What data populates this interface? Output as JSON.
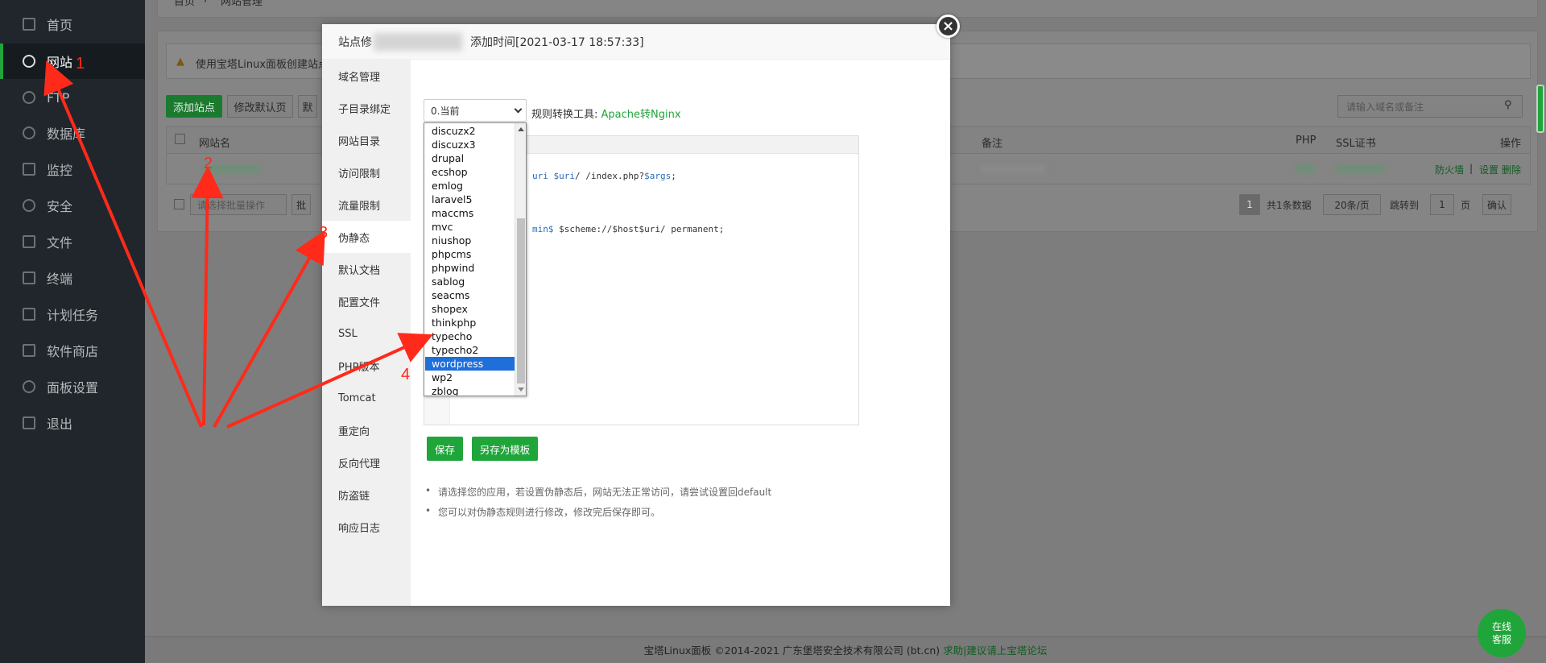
{
  "sidebar": {
    "items": [
      {
        "label": "首页",
        "icon": "home-icon"
      },
      {
        "label": "网站",
        "icon": "globe-icon"
      },
      {
        "label": "FTP",
        "icon": "ftp-icon"
      },
      {
        "label": "数据库",
        "icon": "database-icon"
      },
      {
        "label": "监控",
        "icon": "monitor-icon"
      },
      {
        "label": "安全",
        "icon": "shield-icon"
      },
      {
        "label": "文件",
        "icon": "folder-icon"
      },
      {
        "label": "终端",
        "icon": "terminal-icon"
      },
      {
        "label": "计划任务",
        "icon": "calendar-icon"
      },
      {
        "label": "软件商店",
        "icon": "apps-icon"
      },
      {
        "label": "面板设置",
        "icon": "gear-icon"
      },
      {
        "label": "退出",
        "icon": "logout-icon"
      }
    ]
  },
  "breadcrumb": {
    "home": "首页",
    "sep": "/",
    "current": "网站管理"
  },
  "notice": {
    "text": "使用宝塔Linux面板创建站点时"
  },
  "toolbar": {
    "add_site": "添加站点",
    "modify_default_page": "修改默认页",
    "default_site": "默"
  },
  "search": {
    "placeholder": "请输入域名或备注"
  },
  "table": {
    "headers": {
      "site_name": "网站名",
      "remark": "备注",
      "php": "PHP",
      "ssl": "SSL证书",
      "actions": "操作"
    },
    "row_actions": {
      "firewall": "防火墙",
      "settings": "设置",
      "delete": "删除",
      "sep": "|"
    }
  },
  "batch": {
    "placeholder": "请选择批量操作",
    "button": "批"
  },
  "pagination": {
    "page": "1",
    "total": "共1条数据",
    "per_page": "20条/页",
    "jump_label": "跳转到",
    "jump_value": "1",
    "page_unit": "页",
    "confirm": "确认"
  },
  "modal": {
    "title_prefix": "站点修",
    "title_time": "添加时间[2021-03-17 18:57:33]",
    "tabs": [
      "域名管理",
      "子目录绑定",
      "网站目录",
      "访问限制",
      "流量限制",
      "伪静态",
      "默认文档",
      "配置文件",
      "SSL",
      "PHP版本",
      "Tomcat",
      "重定向",
      "反向代理",
      "防盗链",
      "响应日志"
    ],
    "active_tab": "伪静态",
    "select_value": "0.当前",
    "tool_label": "规则转换工具:",
    "tool_link": "Apache转Nginx",
    "code_line1_a": "uri ",
    "code_line1_b": "$uri",
    "code_line1_c": "/ /index.php?",
    "code_line1_d": "$args",
    "code_line1_e": ";",
    "code_line2_a": "min$ ",
    "code_line2_b": "$scheme://$host$uri/ permanent;",
    "dropdown_options": [
      "discuzx2",
      "discuzx3",
      "drupal",
      "ecshop",
      "emlog",
      "laravel5",
      "maccms",
      "mvc",
      "niushop",
      "phpcms",
      "phpwind",
      "sablog",
      "seacms",
      "shopex",
      "thinkphp",
      "typecho",
      "typecho2",
      "wordpress",
      "wp2",
      "zblog"
    ],
    "selected_option": "wordpress",
    "save": "保存",
    "save_template": "另存为模板",
    "tips": [
      "请选择您的应用，若设置伪静态后，网站无法正常访问，请尝试设置回default",
      "您可以对伪静态规则进行修改，修改完后保存即可。"
    ],
    "close_icon": "×"
  },
  "annotations": [
    "1",
    "2",
    "3",
    "4"
  ],
  "footer": {
    "text": "宝塔Linux面板 ©2014-2021 广东堡塔安全技术有限公司 (bt.cn)",
    "link": "求助|建议请上宝塔论坛"
  },
  "service": {
    "line1": "在线",
    "line2": "客服"
  },
  "colors": {
    "accent": "#20a53a",
    "sidebar_bg": "#20262c",
    "annotation": "#ff2a1a",
    "selection": "#1e6fd9"
  }
}
